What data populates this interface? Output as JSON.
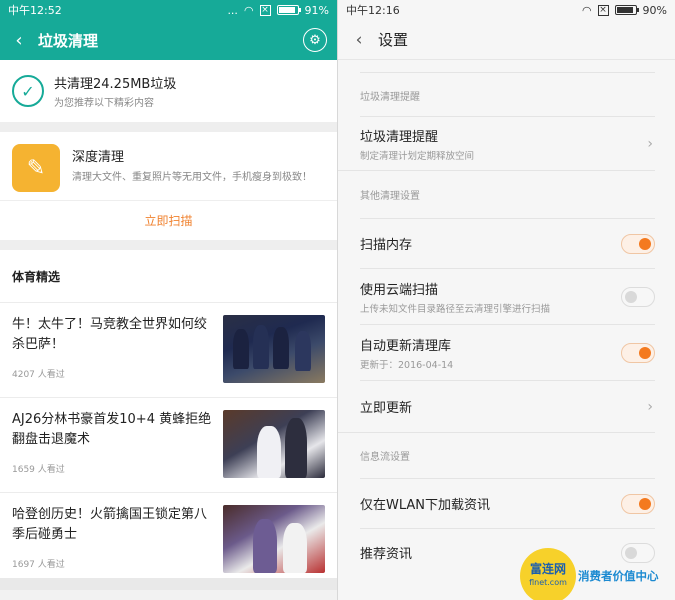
{
  "left": {
    "status": {
      "time": "中午12:52",
      "dots": "...",
      "battery": "91%",
      "battery_level": 0.91
    },
    "title": "垃圾清理",
    "summary": {
      "main": "共清理24.25MB垃圾",
      "sub": "为您推荐以下精彩内容"
    },
    "deep_clean": {
      "title": "深度清理",
      "desc": "清理大文件、重复照片等无用文件，手机瘦身到极致！",
      "action": "立即扫描"
    },
    "section_title": "体育精选",
    "news": [
      {
        "title": "牛！太牛了！马竞教全世界如何绞杀巴萨！",
        "views": "4207 人看过"
      },
      {
        "title": "AJ26分林书豪首发10+4 黄蜂拒绝翻盘击退魔术",
        "views": "1659 人看过"
      },
      {
        "title": "哈登创历史！火箭擒国王锁定第八 季后碰勇士",
        "views": "1697 人看过"
      }
    ]
  },
  "right": {
    "status": {
      "time": "中午12:16",
      "battery": "90%",
      "battery_level": 0.9
    },
    "title": "设置",
    "groups": [
      {
        "header": "垃圾清理提醒"
      },
      {
        "header": "其他清理设置"
      },
      {
        "header": "信息流设置"
      }
    ],
    "rows": {
      "reminder": {
        "label": "垃圾清理提醒",
        "desc": "制定清理计划定期释放空间"
      },
      "scan_memory": {
        "label": "扫描内存",
        "on": true
      },
      "cloud_scan": {
        "label": "使用云端扫描",
        "desc": "上传未知文件目录路径至云清理引擎进行扫描",
        "on": false
      },
      "auto_update": {
        "label": "自动更新清理库",
        "desc": "更新于：2016-04-14",
        "on": true
      },
      "update_now": {
        "label": "立即更新"
      },
      "wlan_only": {
        "label": "仅在WLAN下加载资讯",
        "on": true
      },
      "recommend": {
        "label": "推荐资讯",
        "on": false
      }
    }
  },
  "watermark": {
    "badge_main": "富连网",
    "badge_sub": "flnet.com",
    "slogan": "消费者价值中心"
  },
  "colors": {
    "accent_teal": "#16aa98",
    "accent_orange": "#f47a1f",
    "icon_yellow": "#f5b331"
  }
}
